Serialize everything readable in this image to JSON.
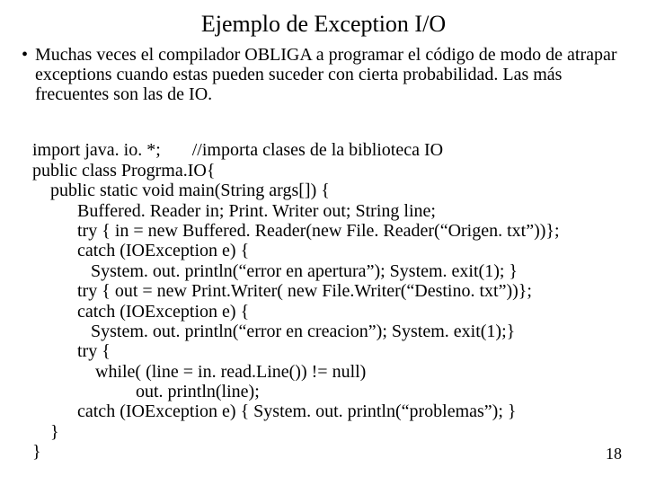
{
  "title": "Ejemplo de Exception I/O",
  "bullet": "Muchas veces el compilador OBLIGA a programar el código de modo de atrapar exceptions cuando estas pueden suceder con cierta probabilidad. Las más frecuentes son las de IO.",
  "code": {
    "l01": "import java. io. *;       //importa clases de la biblioteca IO",
    "l02": "public class Progrma.IO{",
    "l03": "    public static void main(String args[]) {",
    "l04": "          Buffered. Reader in; Print. Writer out; String line;",
    "l05": "          try { in = new Buffered. Reader(new File. Reader(“Origen. txt”))};",
    "l06": "          catch (IOException e) {",
    "l07": "             System. out. println(“error en apertura”); System. exit(1); }",
    "l08": "          try { out = new Print.Writer( new File.Writer(“Destino. txt”))};",
    "l09": "          catch (IOException e) {",
    "l10": "             System. out. println(“error en creacion”); System. exit(1);}",
    "l11": "          try {",
    "l12": "              while( (line = in. read.Line()) != null)",
    "l13": "                       out. println(line);",
    "l14": "          catch (IOException e) { System. out. println(“problemas”); }",
    "l15": "    }",
    "l16": "}"
  },
  "pagenum": "18"
}
